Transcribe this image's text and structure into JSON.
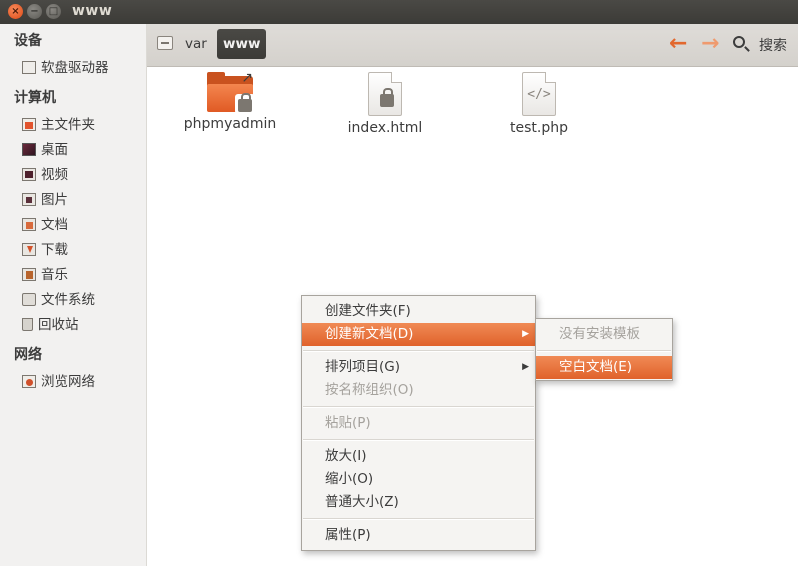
{
  "window": {
    "title": "www",
    "close": "×",
    "minimize": "−",
    "maximize": "□"
  },
  "sidebar": {
    "sections": [
      {
        "title": "设备",
        "items": [
          {
            "label": "软盘驱动器",
            "icon": "floppy-drive-icon"
          }
        ]
      },
      {
        "title": "计算机",
        "items": [
          {
            "label": "主文件夹",
            "icon": "home-folder-icon"
          },
          {
            "label": "桌面",
            "icon": "desktop-icon"
          },
          {
            "label": "视频",
            "icon": "videos-folder-icon"
          },
          {
            "label": "图片",
            "icon": "pictures-folder-icon"
          },
          {
            "label": "文档",
            "icon": "documents-folder-icon"
          },
          {
            "label": "下载",
            "icon": "downloads-folder-icon"
          },
          {
            "label": "音乐",
            "icon": "music-folder-icon"
          },
          {
            "label": "文件系统",
            "icon": "filesystem-icon"
          },
          {
            "label": "回收站",
            "icon": "trash-icon"
          }
        ]
      },
      {
        "title": "网络",
        "items": [
          {
            "label": "浏览网络",
            "icon": "network-icon"
          }
        ]
      }
    ]
  },
  "toolbar": {
    "breadcrumbs": [
      "var",
      "www"
    ],
    "back_arrow": "🡐",
    "forward_arrow": "🡒",
    "search_label": "搜索"
  },
  "files": [
    {
      "name": "phpmyadmin",
      "type": "folder",
      "locked": true,
      "symlink": true
    },
    {
      "name": "index.html",
      "type": "file",
      "locked": true
    },
    {
      "name": "test.php",
      "type": "script"
    }
  ],
  "context_menu": {
    "items": [
      {
        "label": "创建文件夹(F)",
        "enabled": true
      },
      {
        "label": "创建新文档(D)",
        "enabled": true,
        "highlighted": true,
        "submenu": true
      },
      {
        "label": "排列项目(G)",
        "enabled": true,
        "submenu": true
      },
      {
        "label": "按名称组织(O)",
        "enabled": false
      },
      {
        "label": "粘贴(P)",
        "enabled": false
      },
      {
        "label": "放大(I)",
        "enabled": true
      },
      {
        "label": "缩小(O)",
        "enabled": true
      },
      {
        "label": "普通大小(Z)",
        "enabled": true
      },
      {
        "label": "属性(P)",
        "enabled": true
      }
    ],
    "submenu_arrow": "▶"
  },
  "submenu": {
    "items": [
      {
        "label": "没有安装模板",
        "enabled": false
      },
      {
        "label": "空白文档(E)",
        "enabled": true,
        "highlighted": true
      }
    ]
  },
  "colors": {
    "accent": "#e0622b",
    "titlebar": "#3c3b37",
    "sidebar_bg": "#f2f1f0"
  }
}
